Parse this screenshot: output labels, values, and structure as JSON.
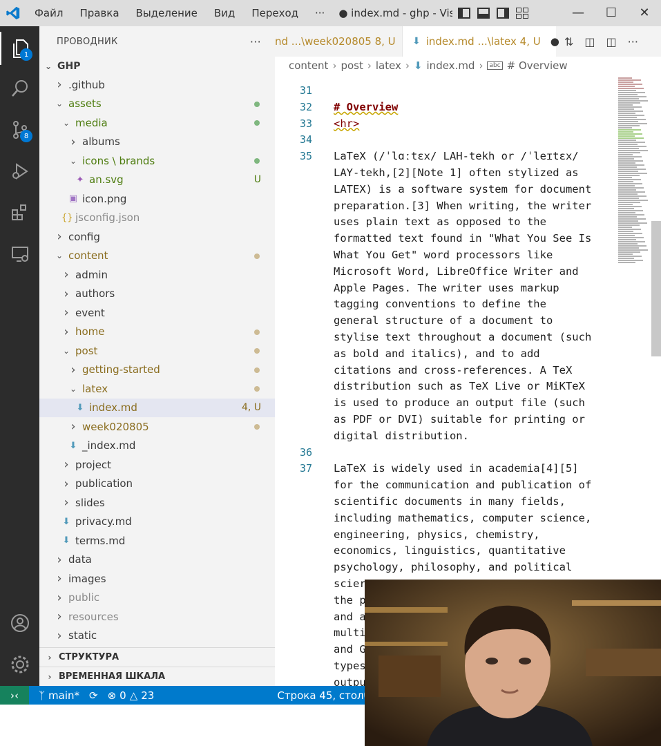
{
  "titlebar": {
    "menu": [
      "Файл",
      "Правка",
      "Выделение",
      "Вид",
      "Переход",
      "···"
    ],
    "title": "● index.md - ghp - Vis...",
    "window_controls": [
      "minimize",
      "maximize",
      "close"
    ]
  },
  "activity": {
    "explorer_badge": "1",
    "scm_badge": "8"
  },
  "sidebar": {
    "title": "ПРОВОДНИК",
    "more": "···",
    "root": "GHP",
    "sections": [
      "СТРУКТУРА",
      "ВРЕМЕННАЯ ШКАЛА"
    ]
  },
  "tree": [
    {
      "label": ".github",
      "indent": 0,
      "kind": "folder-closed",
      "color": "#3b3b3b"
    },
    {
      "label": "assets",
      "indent": 0,
      "kind": "folder-open",
      "color": "#4d7c0f",
      "marker": "dot-green"
    },
    {
      "label": "media",
      "indent": 1,
      "kind": "folder-open",
      "color": "#4d7c0f",
      "marker": "dot-green"
    },
    {
      "label": "albums",
      "indent": 2,
      "kind": "folder-closed",
      "color": "#3b3b3b"
    },
    {
      "label": "icons \\ brands",
      "indent": 2,
      "kind": "folder-open",
      "color": "#4d7c0f",
      "marker": "dot-green"
    },
    {
      "label": "an.svg",
      "indent": 3,
      "kind": "file-svg",
      "color": "#4d7c0f",
      "status": "U"
    },
    {
      "label": "icon.png",
      "indent": 2,
      "kind": "file-image",
      "color": "#3b3b3b"
    },
    {
      "label": "jsconfig.json",
      "indent": 1,
      "kind": "file-json",
      "color": "#8a8a8a"
    },
    {
      "label": "config",
      "indent": 0,
      "kind": "folder-closed",
      "color": "#3b3b3b"
    },
    {
      "label": "content",
      "indent": 0,
      "kind": "folder-open",
      "color": "#8a6d1f",
      "marker": "dot-tan"
    },
    {
      "label": "admin",
      "indent": 1,
      "kind": "folder-closed",
      "color": "#3b3b3b"
    },
    {
      "label": "authors",
      "indent": 1,
      "kind": "folder-closed",
      "color": "#3b3b3b"
    },
    {
      "label": "event",
      "indent": 1,
      "kind": "folder-closed",
      "color": "#3b3b3b"
    },
    {
      "label": "home",
      "indent": 1,
      "kind": "folder-closed",
      "color": "#8a6d1f",
      "marker": "dot-tan"
    },
    {
      "label": "post",
      "indent": 1,
      "kind": "folder-open",
      "color": "#8a6d1f",
      "marker": "dot-tan"
    },
    {
      "label": "getting-started",
      "indent": 2,
      "kind": "folder-closed",
      "color": "#8a6d1f",
      "marker": "dot-tan"
    },
    {
      "label": "latex",
      "indent": 2,
      "kind": "folder-open",
      "color": "#8a6d1f",
      "marker": "dot-tan"
    },
    {
      "label": "index.md",
      "indent": 3,
      "kind": "file-md",
      "color": "#8a6d1f",
      "status": "4, U",
      "selected": true
    },
    {
      "label": "week020805",
      "indent": 2,
      "kind": "folder-closed",
      "color": "#8a6d1f",
      "marker": "dot-tan"
    },
    {
      "label": "_index.md",
      "indent": 2,
      "kind": "file-md",
      "color": "#3b3b3b"
    },
    {
      "label": "project",
      "indent": 1,
      "kind": "folder-closed",
      "color": "#3b3b3b"
    },
    {
      "label": "publication",
      "indent": 1,
      "kind": "folder-closed",
      "color": "#3b3b3b"
    },
    {
      "label": "slides",
      "indent": 1,
      "kind": "folder-closed",
      "color": "#3b3b3b"
    },
    {
      "label": "privacy.md",
      "indent": 1,
      "kind": "file-md",
      "color": "#3b3b3b"
    },
    {
      "label": "terms.md",
      "indent": 1,
      "kind": "file-md",
      "color": "#3b3b3b"
    },
    {
      "label": "data",
      "indent": 0,
      "kind": "folder-closed",
      "color": "#3b3b3b"
    },
    {
      "label": "images",
      "indent": 0,
      "kind": "folder-closed",
      "color": "#3b3b3b"
    },
    {
      "label": "public",
      "indent": 0,
      "kind": "folder-closed",
      "color": "#8a8a8a"
    },
    {
      "label": "resources",
      "indent": 0,
      "kind": "folder-closed",
      "color": "#8a8a8a"
    },
    {
      "label": "static",
      "indent": 0,
      "kind": "folder-closed",
      "color": "#3b3b3b"
    }
  ],
  "tabs": [
    {
      "label": "nd  ...\\week020805  8, U",
      "active": false
    },
    {
      "label": "index.md  ...\\latex  4, U",
      "active": true,
      "dirty": "●"
    }
  ],
  "breadcrumb": [
    "content",
    "post",
    "latex",
    "index.md",
    "# Overview"
  ],
  "editor_lines": [
    {
      "num": "31",
      "text": "",
      "style": "plain"
    },
    {
      "num": "32",
      "text": "# Overview",
      "style": "hdr"
    },
    {
      "num": "33",
      "text": "<hr>",
      "style": "tag"
    },
    {
      "num": "34",
      "text": "",
      "style": "plain"
    },
    {
      "num": "35",
      "text": "LaTeX (/ˈlɑːtɛx/ LAH-tekh or /ˈleɪtɛx/",
      "style": "plain"
    },
    {
      "num": "",
      "text": "LAY-tekh,[2][Note 1] often stylized as",
      "style": "plain"
    },
    {
      "num": "",
      "text": "LATEX) is a software system for document",
      "style": "plain"
    },
    {
      "num": "",
      "text": "preparation.[3] When writing, the writer",
      "style": "plain"
    },
    {
      "num": "",
      "text": "uses plain text as opposed to the",
      "style": "plain"
    },
    {
      "num": "",
      "text": "formatted text found in \"What You See Is",
      "style": "plain"
    },
    {
      "num": "",
      "text": "What You Get\" word processors like",
      "style": "plain"
    },
    {
      "num": "",
      "text": "Microsoft Word, LibreOffice Writer and",
      "style": "plain"
    },
    {
      "num": "",
      "text": "Apple Pages. The writer uses markup",
      "style": "plain"
    },
    {
      "num": "",
      "text": "tagging conventions to define the",
      "style": "plain"
    },
    {
      "num": "",
      "text": "general structure of a document to",
      "style": "plain"
    },
    {
      "num": "",
      "text": "stylise text throughout a document (such",
      "style": "plain"
    },
    {
      "num": "",
      "text": "as bold and italics), and to add",
      "style": "plain"
    },
    {
      "num": "",
      "text": "citations and cross-references. A TeX",
      "style": "plain"
    },
    {
      "num": "",
      "text": "distribution such as TeX Live or MiKTeX",
      "style": "plain"
    },
    {
      "num": "",
      "text": "is used to produce an output file (such",
      "style": "plain"
    },
    {
      "num": "",
      "text": "as PDF or DVI) suitable for printing or",
      "style": "plain"
    },
    {
      "num": "",
      "text": "digital distribution.",
      "style": "plain"
    },
    {
      "num": "36",
      "text": "",
      "style": "plain"
    },
    {
      "num": "37",
      "text": "LaTeX is widely used in academia[4][5]",
      "style": "plain"
    },
    {
      "num": "",
      "text": "for the communication and publication of",
      "style": "plain"
    },
    {
      "num": "",
      "text": "scientific documents in many fields,",
      "style": "plain"
    },
    {
      "num": "",
      "text": "including mathematics, computer science,",
      "style": "plain"
    },
    {
      "num": "",
      "text": "engineering, physics, chemistry,",
      "style": "plain"
    },
    {
      "num": "",
      "text": "economics, linguistics, quantitative",
      "style": "plain"
    },
    {
      "num": "",
      "text": "psychology, philosophy, and political",
      "style": "plain"
    },
    {
      "num": "",
      "text": "scier",
      "style": "plain"
    },
    {
      "num": "",
      "text": "the p",
      "style": "plain"
    },
    {
      "num": "",
      "text": "and a",
      "style": "plain"
    },
    {
      "num": "",
      "text": "multi",
      "style": "plain"
    },
    {
      "num": "",
      "text": "and G",
      "style": "plain"
    },
    {
      "num": "",
      "text": "types",
      "style": "plain"
    },
    {
      "num": "",
      "text": "outpu",
      "style": "plain"
    }
  ],
  "statusbar": {
    "branch": "main*",
    "errors": "0",
    "warnings": "23",
    "position": "Строка 45, столб"
  },
  "colors": {
    "activity_bg": "#2c2c2c",
    "status_bg": "#007acc",
    "accent": "#0078d4"
  }
}
